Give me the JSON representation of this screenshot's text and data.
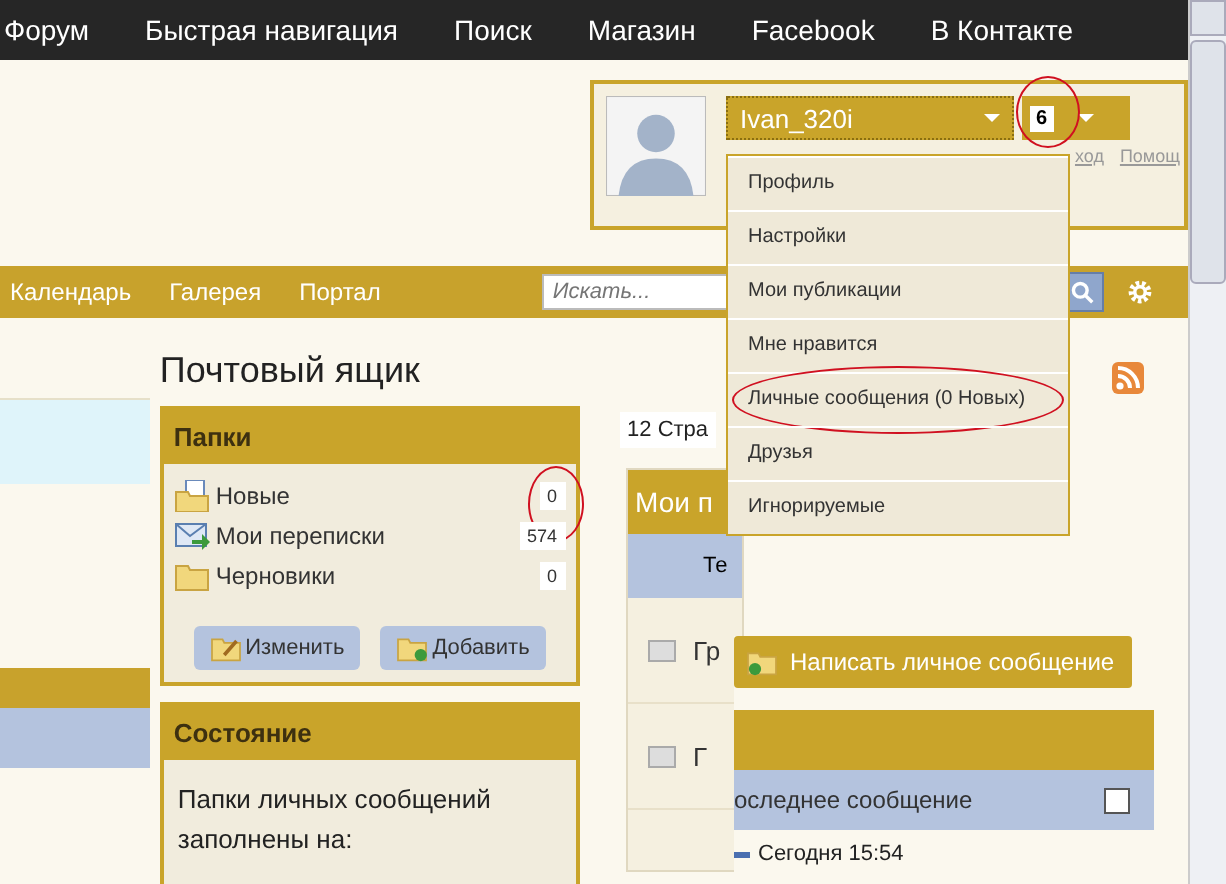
{
  "nav": [
    "Форум",
    "Быстрая навигация",
    "Поиск",
    "Магазин",
    "Facebook",
    "В Контакте"
  ],
  "user": {
    "name": "Ivan_320i",
    "badge": "6",
    "badge_circled": true,
    "links": [
      "ход",
      "Помощ"
    ]
  },
  "menu": [
    {
      "label": "Профиль",
      "circled": false
    },
    {
      "label": "Настройки",
      "circled": false
    },
    {
      "label": "Мои публикации",
      "circled": false
    },
    {
      "label": "Мне нравится",
      "circled": false
    },
    {
      "label": "Личные сообщения (0 Новых)",
      "circled": true
    },
    {
      "label": "Друзья",
      "circled": false
    },
    {
      "label": "Игнорируемые",
      "circled": false
    }
  ],
  "subnav": [
    "Календарь",
    "Галерея",
    "Портал"
  ],
  "search": {
    "placeholder": "Искать..."
  },
  "page_title": "Почтовый ящик",
  "folders": {
    "title": "Папки",
    "items": [
      {
        "kind": "new",
        "name": "Новые",
        "count": "0",
        "circled": true
      },
      {
        "kind": "sent",
        "name": "Мои переписки",
        "count": "574",
        "circled": false
      },
      {
        "kind": "folder",
        "name": "Черновики",
        "count": "0",
        "circled": false
      }
    ],
    "buttons": [
      {
        "kind": "edit",
        "label": "Изменить"
      },
      {
        "kind": "add",
        "label": "Добавить"
      }
    ]
  },
  "status": {
    "title": "Состояние",
    "text": "Папки личных сообщений заполнены на:"
  },
  "pages_text": "12 Стра",
  "messages_panel": {
    "title": "Мои п",
    "column": "Те",
    "rows": [
      "Гр",
      "Г"
    ]
  },
  "compose_button": "Написать личное сообщение",
  "table": {
    "column": "оследнее сообщение",
    "checked": false,
    "row": "Сегодня 15:54"
  }
}
